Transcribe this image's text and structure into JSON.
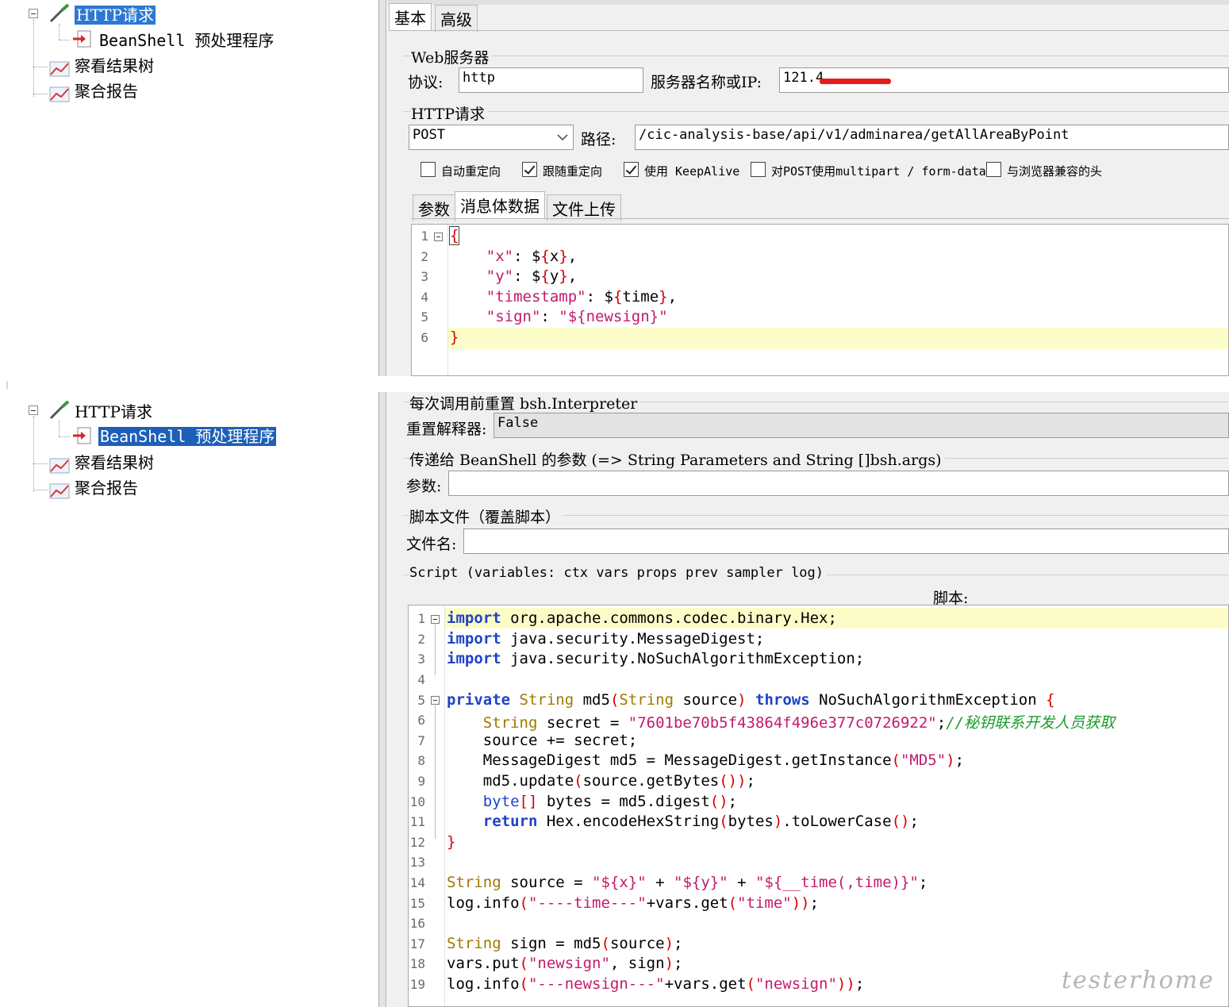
{
  "tree1": {
    "items": [
      {
        "label": "HTTP请求",
        "icon": "pipette-icon",
        "selected": true
      },
      {
        "label": "BeanShell 预处理程序",
        "icon": "preprocessor-icon"
      },
      {
        "label": "察看结果树",
        "icon": "graph-icon"
      },
      {
        "label": "聚合报告",
        "icon": "graph-icon"
      }
    ]
  },
  "tree2": {
    "items": [
      {
        "label": "HTTP请求",
        "icon": "pipette-icon"
      },
      {
        "label": "BeanShell 预处理程序",
        "icon": "preprocessor-icon",
        "selected": true
      },
      {
        "label": "察看结果树",
        "icon": "graph-icon"
      },
      {
        "label": "聚合报告",
        "icon": "graph-icon"
      }
    ]
  },
  "http_panel": {
    "tabs": [
      "基本",
      "高级"
    ],
    "web_server_title": "Web服务器",
    "protocol_label": "协议:",
    "protocol_value": "http",
    "server_label": "服务器名称或IP:",
    "server_value": "121.4",
    "http_request_title": "HTTP请求",
    "method_value": "POST",
    "path_label": "路径:",
    "path_value": "/cic-analysis-base/api/v1/adminarea/getAllAreaByPoint",
    "checkboxes": [
      {
        "label": "自动重定向",
        "checked": false
      },
      {
        "label": "跟随重定向",
        "checked": true
      },
      {
        "label": "使用 KeepAlive",
        "checked": true
      },
      {
        "label": "对POST使用multipart / form-data",
        "checked": false
      },
      {
        "label": "与浏览器兼容的头",
        "checked": false
      }
    ],
    "body_tabs": [
      "参数",
      "消息体数据",
      "文件上传"
    ],
    "body_lines": [
      "1",
      "2",
      "3",
      "4",
      "5",
      "6"
    ]
  },
  "beanshell_panel": {
    "reset_section_title": "每次调用前重置 bsh.Interpreter",
    "reset_label": "重置解释器:",
    "reset_value": "False",
    "params_section_title": "传递给 BeanShell 的参数 (=> String Parameters and String []bsh.args)",
    "params_label": "参数:",
    "params_value": "",
    "file_section_title": "脚本文件（覆盖脚本）",
    "file_label": "文件名:",
    "file_value": "",
    "script_section_title": "Script (variables: ctx vars props prev sampler log)",
    "script_label": "脚本:",
    "script_lines": [
      "1",
      "2",
      "3",
      "4",
      "5",
      "6",
      "7",
      "8",
      "9",
      "10",
      "11",
      "12",
      "13",
      "14",
      "15",
      "16",
      "17",
      "18",
      "19"
    ]
  },
  "watermark": "testerhome",
  "colors": {
    "keyword": "#1f43c6",
    "type": "#a17800",
    "string": "#c21a6a",
    "comment": "#1a9b2d",
    "bracket": "#d40000",
    "current_line": "#fcfcc8",
    "selection": "#2d78d4"
  }
}
